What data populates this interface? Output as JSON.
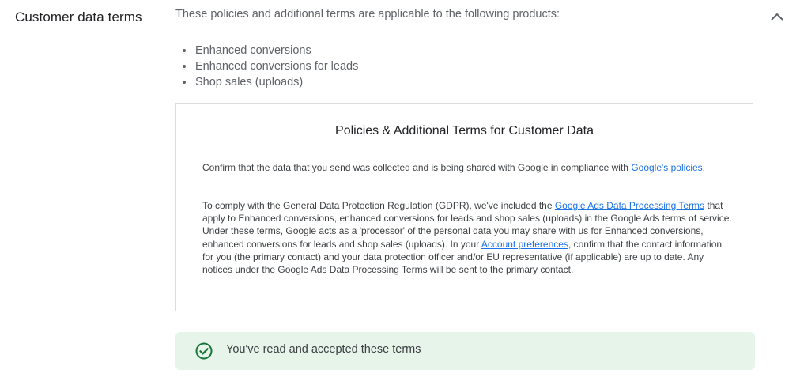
{
  "section": {
    "title": "Customer data terms",
    "intro": "These policies and additional terms are applicable to the following products:",
    "collapse_icon": "chevron-up-icon",
    "products": [
      "Enhanced conversions",
      "Enhanced conversions for leads",
      "Shop sales (uploads)"
    ]
  },
  "terms": {
    "title": "Policies & Additional Terms for Customer Data",
    "para1": {
      "text_before": "Confirm that the data that you send was collected and is being shared with Google in compliance with ",
      "link": "Google's policies",
      "text_after": "."
    },
    "para2": {
      "text_before": "To comply with the General Data Protection Regulation (GDPR), we've included the ",
      "link1": "Google Ads Data Processing Terms",
      "text_middle": " that apply to Enhanced conversions, enhanced conversions for leads and shop sales (uploads) in the Google Ads terms of service. Under these terms, Google acts as a 'processor' of the personal data you may share with us for Enhanced conversions, enhanced conversions for leads and shop sales (uploads). In your ",
      "link2": "Account preferences",
      "text_after": ", confirm that the contact information for you (the primary contact) and your data protection officer and/or EU representative (if applicable) are up to date. Any notices under the Google Ads Data Processing Terms will be sent to the primary contact."
    }
  },
  "status": {
    "text": "You've read and accepted these terms",
    "icon": "check-circle-icon",
    "color": "#137333",
    "background": "#e6f4ea"
  }
}
